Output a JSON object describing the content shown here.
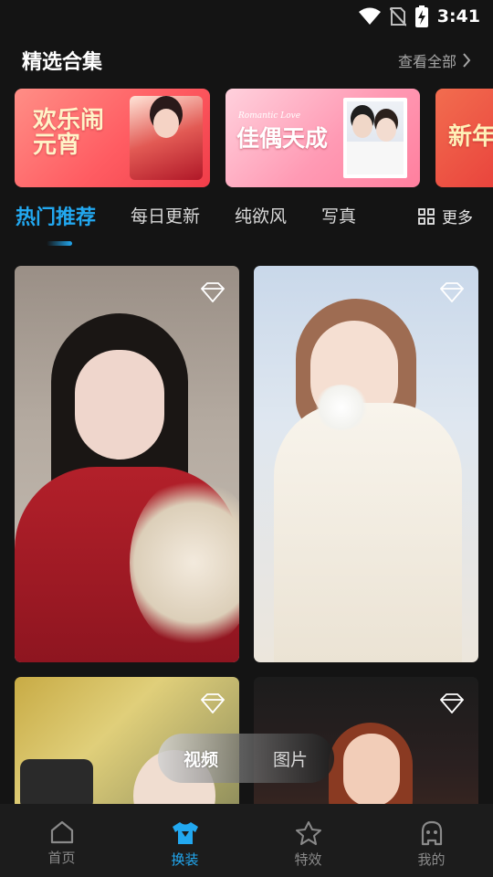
{
  "status_bar": {
    "time": "3:41",
    "icons": [
      "wifi-icon",
      "no-sim-icon",
      "battery-charging-icon"
    ]
  },
  "collection": {
    "title": "精选合集",
    "see_all_label": "查看全部",
    "banners": [
      {
        "text": "欢乐闹元宵"
      },
      {
        "subtitle": "Romantic Love",
        "text": "佳偶天成"
      },
      {
        "text": "新年"
      }
    ]
  },
  "tabs": {
    "items": [
      {
        "label": "热门推荐",
        "active": true
      },
      {
        "label": "每日更新",
        "active": false
      },
      {
        "label": "纯欲风",
        "active": false
      },
      {
        "label": "写真",
        "active": false
      }
    ],
    "more_label": "更多"
  },
  "grid": {
    "cards": [
      {
        "icon": "diamond-icon"
      },
      {
        "icon": "diamond-icon"
      },
      {
        "icon": "diamond-icon"
      },
      {
        "icon": "diamond-icon"
      }
    ]
  },
  "media_toggle": {
    "video_label": "视频",
    "picture_label": "图片",
    "selected": "视频"
  },
  "bottom_nav": {
    "items": [
      {
        "label": "首页",
        "icon": "home-icon",
        "active": false
      },
      {
        "label": "换装",
        "icon": "tshirt-icon",
        "active": true
      },
      {
        "label": "特效",
        "icon": "star-icon",
        "active": false
      },
      {
        "label": "我的",
        "icon": "profile-icon",
        "active": false
      }
    ]
  },
  "colors": {
    "accent": "#22a8f0",
    "background": "#141414",
    "nav_background": "#1c1c1c"
  }
}
